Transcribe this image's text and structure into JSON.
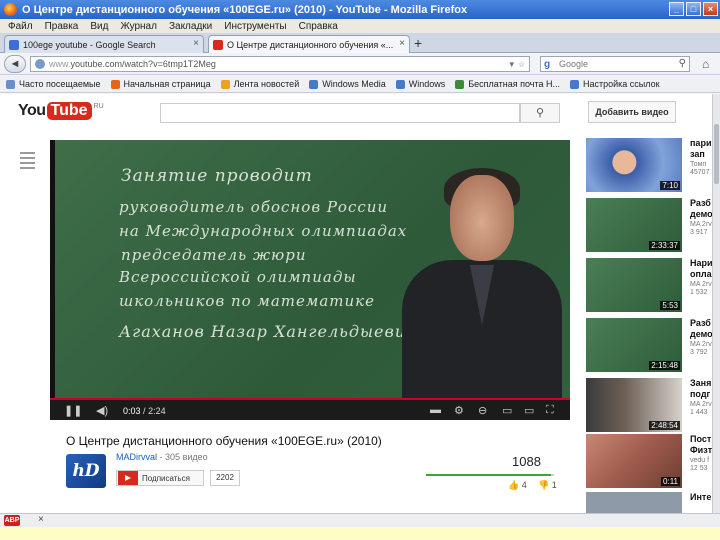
{
  "window": {
    "title": "О Центре дистанционного обучения «100EGE.ru» (2010) - YouTube - Mozilla Firefox",
    "buttons": [
      "_",
      "□",
      "×"
    ]
  },
  "menu": [
    "Файл",
    "Правка",
    "Вид",
    "Журнал",
    "Закладки",
    "Инструменты",
    "Справка"
  ],
  "tabs": [
    {
      "label": "100ege youtube - Google Search",
      "active": false,
      "close": "×"
    },
    {
      "label": "О Центре дистанционного обучения «...",
      "active": true,
      "close": "×"
    }
  ],
  "new_tab": "+",
  "nav": {
    "back": "◄",
    "url_prefix": "www.",
    "url": "youtube.com/watch?v=6tmp1T2Meg",
    "search_engine": "g",
    "search_placeholder": "Google",
    "home": "⌂"
  },
  "bookmarks": [
    {
      "label": "Часто посещаемые",
      "color": "#6c8ec8"
    },
    {
      "label": "Начальная страница",
      "color": "#e8641b"
    },
    {
      "label": "Лента новостей",
      "color": "#f0a020"
    },
    {
      "label": "Windows Media",
      "color": "#4a78c8"
    },
    {
      "label": "Windows",
      "color": "#4a78c8"
    },
    {
      "label": "Бесплатная почта H...",
      "color": "#3a8a3a"
    },
    {
      "label": "Настройка ссылок",
      "color": "#4a78c8"
    }
  ],
  "youtube": {
    "logo_you": "You",
    "logo_tube": "Tube",
    "logo_region": "RU",
    "search_icon": "🔍",
    "add_video": "Добавить видео",
    "board_lines": [
      "Занятие проводит",
      "руководитель обоснов России",
      "на Международных олимпиадах",
      "председатель жюри",
      "Всероссийской олимпиады",
      "школьников по математике",
      "Агаханов Назар Хангельдыевич"
    ],
    "player": {
      "time_current": "0:03",
      "time_sep": "/",
      "time_total": "2:24",
      "progress": 0.02
    },
    "video_title": "О Центре дистанционного обучения «100EGE.ru» (2010)",
    "channel": {
      "avatar_text": "hD",
      "name": "MADirvval",
      "separator": "·",
      "video_count": "305 видео",
      "subscribe": "Подписаться",
      "subscribers": "2202"
    },
    "views": "1088",
    "view_bar_fill": 0.98,
    "likes": "4",
    "dislikes": "1",
    "related": [
      {
        "title": "пари",
        "line2": "зап",
        "line3": "Томп",
        "line4": "45707",
        "duration": "7:10"
      },
      {
        "title": "Разб",
        "line2": "демо",
        "line3": "MA 2rv",
        "line4": "3 917",
        "duration": "2:33:37"
      },
      {
        "title": "Нари",
        "line2": "опла",
        "line3": "MA 2rv",
        "line4": "1 532",
        "duration": "5:53"
      },
      {
        "title": "Разб",
        "line2": "демо",
        "line3": "MA 2rv",
        "line4": "3 792",
        "duration": "2:15:48"
      },
      {
        "title": "Заня",
        "line2": "подг",
        "line3": "MA 2rv",
        "line4": "1 443",
        "duration": "2:48:54"
      },
      {
        "title": "Пост",
        "line2": "Физт",
        "line3": "vedu f",
        "line4": "12 53",
        "duration": "0:11"
      },
      {
        "title": "Инте",
        "line2": "",
        "line3": "",
        "line4": "",
        "duration": ""
      }
    ]
  },
  "status": {
    "abp": "ABP",
    "close": "×"
  }
}
